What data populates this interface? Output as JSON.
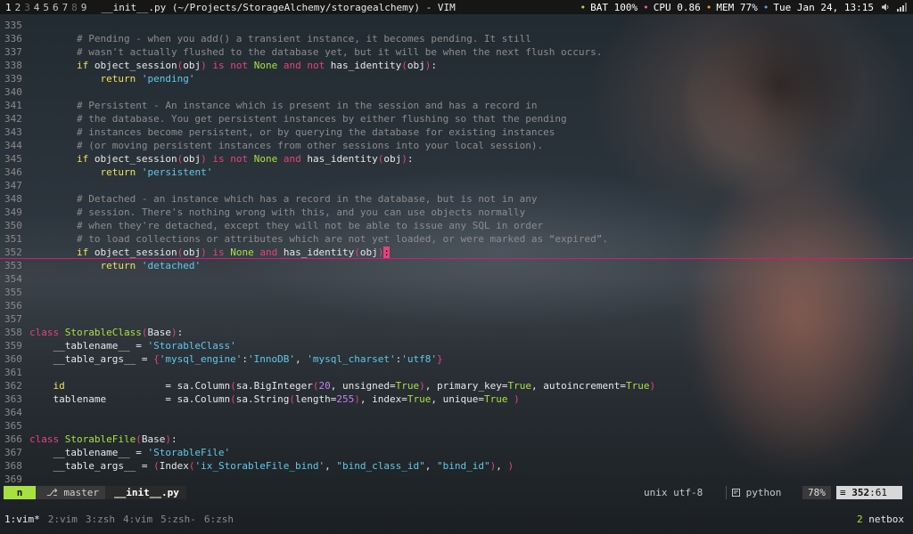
{
  "topbar": {
    "workspaces": [
      {
        "label": "1",
        "state": "active"
      },
      {
        "label": "2",
        "state": "occupied"
      },
      {
        "label": "3",
        "state": "empty"
      },
      {
        "label": "4",
        "state": "occupied"
      },
      {
        "label": "5",
        "state": "occupied"
      },
      {
        "label": "6",
        "state": "occupied"
      },
      {
        "label": "7",
        "state": "occupied"
      },
      {
        "label": "8",
        "state": "empty"
      },
      {
        "label": "9",
        "state": "occupied"
      }
    ],
    "window_title": "__init__.py (~/Projects/StorageAlchemy/storagealchemy) - VIM",
    "bat_label": "BAT",
    "bat_value": "100%",
    "cpu_label": "CPU",
    "cpu_value": "0.86",
    "mem_label": "MEM",
    "mem_value": "77%",
    "datetime": "Tue Jan 24, 13:15",
    "dot": "•",
    "tray_icons": [
      "volume-icon",
      "signal-icon"
    ]
  },
  "editor": {
    "lines": [
      {
        "n": "335",
        "segs": []
      },
      {
        "n": "336",
        "segs": [
          [
            "c-comment",
            "        # Pending - when you add() a transient instance, it becomes pending. It still"
          ]
        ]
      },
      {
        "n": "337",
        "segs": [
          [
            "c-comment",
            "        # wasn't actually flushed to the database yet, but it will be when the next flush occurs."
          ]
        ]
      },
      {
        "n": "338",
        "segs": [
          [
            "c-plain",
            "        "
          ],
          [
            "c-kw2",
            "if"
          ],
          [
            "c-plain",
            " object_session"
          ],
          [
            "c-paren",
            "("
          ],
          [
            "c-plain",
            "obj"
          ],
          [
            "c-paren",
            ")"
          ],
          [
            "c-plain",
            " "
          ],
          [
            "c-kw",
            "is not"
          ],
          [
            "c-plain",
            " "
          ],
          [
            "c-const",
            "None"
          ],
          [
            "c-plain",
            " "
          ],
          [
            "c-kw",
            "and not"
          ],
          [
            "c-plain",
            " has_identity"
          ],
          [
            "c-paren",
            "("
          ],
          [
            "c-plain",
            "obj"
          ],
          [
            "c-paren",
            ")"
          ],
          [
            "c-plain",
            ":"
          ]
        ]
      },
      {
        "n": "339",
        "segs": [
          [
            "c-plain",
            "            "
          ],
          [
            "c-kw2",
            "return"
          ],
          [
            "c-plain",
            " "
          ],
          [
            "c-str",
            "'pending'"
          ]
        ]
      },
      {
        "n": "340",
        "segs": []
      },
      {
        "n": "341",
        "segs": [
          [
            "c-comment",
            "        # Persistent - An instance which is present in the session and has a record in"
          ]
        ]
      },
      {
        "n": "342",
        "segs": [
          [
            "c-comment",
            "        # the database. You get persistent instances by either flushing so that the pending"
          ]
        ]
      },
      {
        "n": "343",
        "segs": [
          [
            "c-comment",
            "        # instances become persistent, or by querying the database for existing instances"
          ]
        ]
      },
      {
        "n": "344",
        "segs": [
          [
            "c-comment",
            "        # (or moving persistent instances from other sessions into your local session)."
          ]
        ]
      },
      {
        "n": "345",
        "segs": [
          [
            "c-plain",
            "        "
          ],
          [
            "c-kw2",
            "if"
          ],
          [
            "c-plain",
            " object_session"
          ],
          [
            "c-paren",
            "("
          ],
          [
            "c-plain",
            "obj"
          ],
          [
            "c-paren",
            ")"
          ],
          [
            "c-plain",
            " "
          ],
          [
            "c-kw",
            "is not"
          ],
          [
            "c-plain",
            " "
          ],
          [
            "c-const",
            "None"
          ],
          [
            "c-plain",
            " "
          ],
          [
            "c-kw",
            "and"
          ],
          [
            "c-plain",
            " has_identity"
          ],
          [
            "c-paren",
            "("
          ],
          [
            "c-plain",
            "obj"
          ],
          [
            "c-paren",
            ")"
          ],
          [
            "c-plain",
            ":"
          ]
        ]
      },
      {
        "n": "346",
        "segs": [
          [
            "c-plain",
            "            "
          ],
          [
            "c-kw2",
            "return"
          ],
          [
            "c-plain",
            " "
          ],
          [
            "c-str",
            "'persistent'"
          ]
        ]
      },
      {
        "n": "347",
        "segs": []
      },
      {
        "n": "348",
        "segs": [
          [
            "c-comment",
            "        # Detached - an instance which has a record in the database, but is not in any"
          ]
        ]
      },
      {
        "n": "349",
        "segs": [
          [
            "c-comment",
            "        # session. There's nothing wrong with this, and you can use objects normally"
          ]
        ]
      },
      {
        "n": "350",
        "segs": [
          [
            "c-comment",
            "        # when they're detached, except they will not be able to issue any SQL in order"
          ]
        ]
      },
      {
        "n": "351",
        "segs": [
          [
            "c-comment",
            "        # to load collections or attributes which are not yet loaded, or were marked as “expired”."
          ]
        ]
      },
      {
        "n": "352",
        "cursorline": true,
        "segs": [
          [
            "c-plain",
            "        "
          ],
          [
            "c-kw2",
            "if"
          ],
          [
            "c-plain",
            " object_session"
          ],
          [
            "c-paren",
            "("
          ],
          [
            "c-plain",
            "obj"
          ],
          [
            "c-paren",
            ")"
          ],
          [
            "c-plain",
            " "
          ],
          [
            "c-kw",
            "is"
          ],
          [
            "c-plain",
            " "
          ],
          [
            "c-const",
            "None"
          ],
          [
            "c-plain",
            " "
          ],
          [
            "c-kw",
            "and"
          ],
          [
            "c-plain",
            " has_identity"
          ],
          [
            "c-paren",
            "("
          ],
          [
            "c-plain",
            "obj"
          ],
          [
            "c-paren",
            ")"
          ],
          [
            "cursor",
            ":"
          ]
        ]
      },
      {
        "n": "353",
        "segs": [
          [
            "c-plain",
            "            "
          ],
          [
            "c-kw2",
            "return"
          ],
          [
            "c-plain",
            " "
          ],
          [
            "c-str",
            "'detached'"
          ]
        ]
      },
      {
        "n": "354",
        "segs": []
      },
      {
        "n": "355",
        "segs": []
      },
      {
        "n": "356",
        "segs": []
      },
      {
        "n": "357",
        "segs": []
      },
      {
        "n": "358",
        "segs": [
          [
            "c-cls",
            "class"
          ],
          [
            "c-plain",
            " "
          ],
          [
            "c-name",
            "StorableClass"
          ],
          [
            "c-paren",
            "("
          ],
          [
            "c-plain",
            "Base"
          ],
          [
            "c-paren",
            ")"
          ],
          [
            "c-plain",
            ":"
          ]
        ]
      },
      {
        "n": "359",
        "segs": [
          [
            "c-plain",
            "    __tablename__ = "
          ],
          [
            "c-str",
            "'StorableClass'"
          ]
        ]
      },
      {
        "n": "360",
        "segs": [
          [
            "c-plain",
            "    __table_args__ = "
          ],
          [
            "c-paren",
            "{"
          ],
          [
            "c-str",
            "'mysql_engine'"
          ],
          [
            "c-plain",
            ":"
          ],
          [
            "c-str",
            "'InnoDB'"
          ],
          [
            "c-plain",
            ", "
          ],
          [
            "c-str",
            "'mysql_charset'"
          ],
          [
            "c-plain",
            ":"
          ],
          [
            "c-str",
            "'utf8'"
          ],
          [
            "c-paren",
            "}"
          ]
        ]
      },
      {
        "n": "361",
        "segs": []
      },
      {
        "n": "362",
        "segs": [
          [
            "c-plain",
            "    "
          ],
          [
            "c-kw2",
            "id"
          ],
          [
            "c-plain",
            "                 = sa.Column"
          ],
          [
            "c-paren",
            "("
          ],
          [
            "c-plain",
            "sa.BigInteger"
          ],
          [
            "c-paren",
            "("
          ],
          [
            "c-num",
            "20"
          ],
          [
            "c-plain",
            ", unsigned="
          ],
          [
            "c-const",
            "True"
          ],
          [
            "c-paren",
            ")"
          ],
          [
            "c-plain",
            ", primary_key="
          ],
          [
            "c-const",
            "True"
          ],
          [
            "c-plain",
            ", autoincrement="
          ],
          [
            "c-const",
            "True"
          ],
          [
            "c-paren",
            ")"
          ]
        ]
      },
      {
        "n": "363",
        "segs": [
          [
            "c-plain",
            "    tablename          = sa.Column"
          ],
          [
            "c-paren",
            "("
          ],
          [
            "c-plain",
            "sa.String"
          ],
          [
            "c-paren",
            "("
          ],
          [
            "c-plain",
            "length="
          ],
          [
            "c-num",
            "255"
          ],
          [
            "c-paren",
            ")"
          ],
          [
            "c-plain",
            ", index="
          ],
          [
            "c-const",
            "True"
          ],
          [
            "c-plain",
            ", unique="
          ],
          [
            "c-const",
            "True"
          ],
          [
            "c-plain",
            " "
          ],
          [
            "c-paren",
            ")"
          ]
        ]
      },
      {
        "n": "364",
        "segs": []
      },
      {
        "n": "365",
        "segs": []
      },
      {
        "n": "366",
        "segs": [
          [
            "c-cls",
            "class"
          ],
          [
            "c-plain",
            " "
          ],
          [
            "c-name",
            "StorableFile"
          ],
          [
            "c-paren",
            "("
          ],
          [
            "c-plain",
            "Base"
          ],
          [
            "c-paren",
            ")"
          ],
          [
            "c-plain",
            ":"
          ]
        ]
      },
      {
        "n": "367",
        "segs": [
          [
            "c-plain",
            "    __tablename__ = "
          ],
          [
            "c-str",
            "'StorableFile'"
          ]
        ]
      },
      {
        "n": "368",
        "segs": [
          [
            "c-plain",
            "    __table_args__ = "
          ],
          [
            "c-paren",
            "("
          ],
          [
            "c-plain",
            "Index"
          ],
          [
            "c-paren",
            "("
          ],
          [
            "c-str",
            "'ix_StorableFile_bind'"
          ],
          [
            "c-plain",
            ", "
          ],
          [
            "c-str",
            "\"bind_class_id\""
          ],
          [
            "c-plain",
            ", "
          ],
          [
            "c-str",
            "\"bind_id\""
          ],
          [
            "c-paren",
            ")"
          ],
          [
            "c-plain",
            ", "
          ],
          [
            "c-paren",
            ")"
          ]
        ]
      },
      {
        "n": "369",
        "segs": []
      }
    ]
  },
  "statusline": {
    "mode": "n",
    "branch_icon": "⎇",
    "branch": "master",
    "filename": "__init__.py",
    "encoding": "unix utf-8",
    "filetype_icon": "python-icon",
    "filetype": "python",
    "percent": "78%",
    "line_icon": "≡",
    "line": "352",
    "col": "61"
  },
  "tmux": {
    "windows": [
      {
        "label": "1:vim*",
        "active": true
      },
      {
        "label": "2:vim",
        "active": false
      },
      {
        "label": "3:zsh",
        "active": false
      },
      {
        "label": "4:vim",
        "active": false
      },
      {
        "label": "5:zsh-",
        "active": false
      },
      {
        "label": "6:zsh",
        "active": false
      }
    ],
    "session_count": "2",
    "hostname": "netbox"
  }
}
